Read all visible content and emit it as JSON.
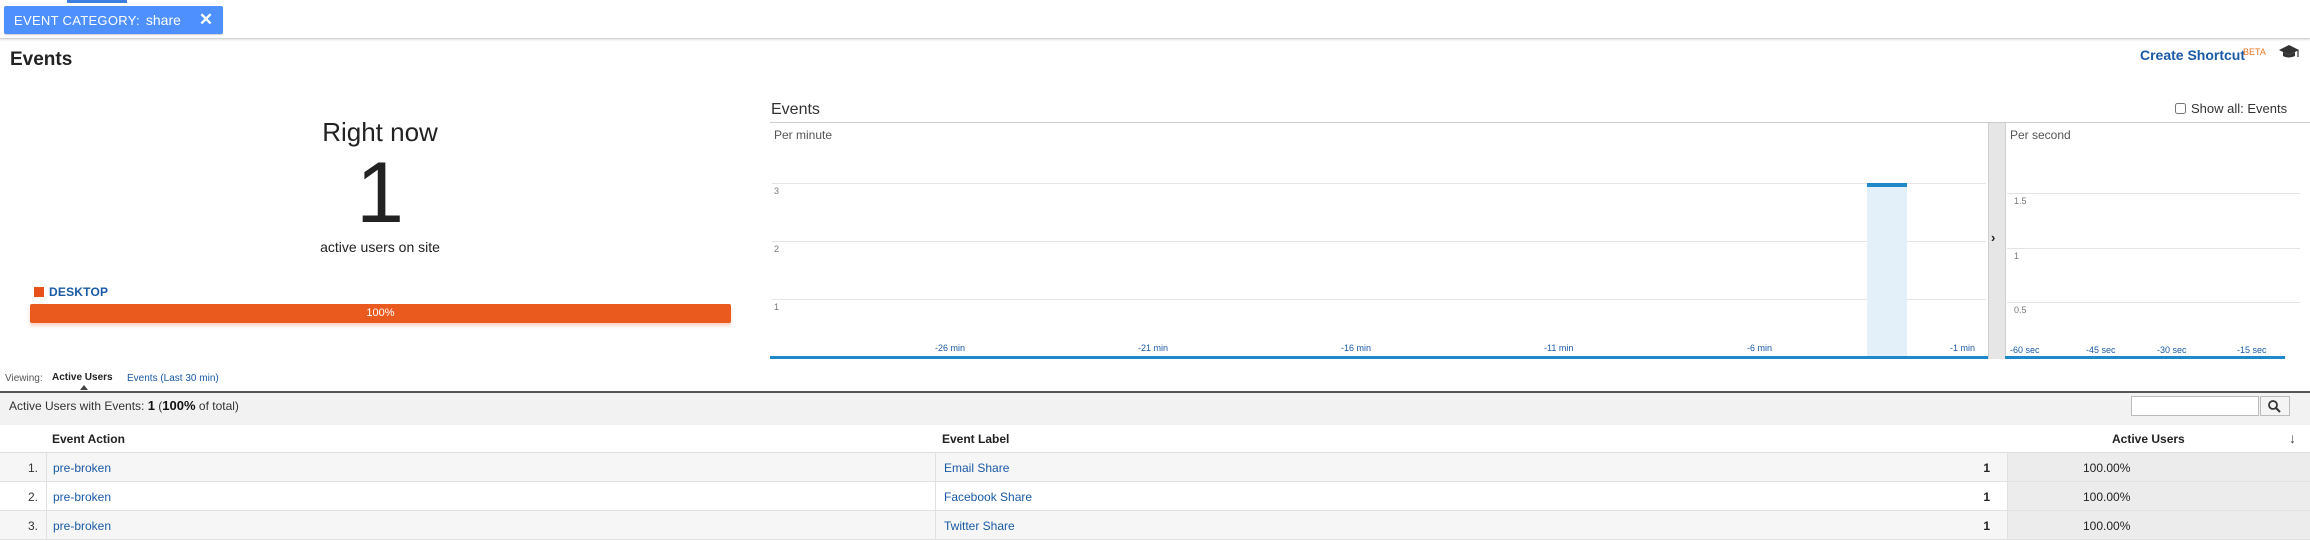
{
  "filter": {
    "key": "EVENT CATEGORY:",
    "value": "share",
    "remove_label": "✕"
  },
  "page_title": "Events",
  "header": {
    "create_shortcut": "Create Shortcut",
    "beta": "BETA",
    "icon": "graduation-cap-icon"
  },
  "right_now": {
    "title": "Right now",
    "count": "1",
    "subtitle": "active users on site",
    "device_label": "DESKTOP",
    "device_percent_label": "100%",
    "device_share": 1.0,
    "device_color": "#ea5a1f"
  },
  "events_chart": {
    "title": "Events",
    "show_all_label": "Show all: Events",
    "show_all_checked": false,
    "per_minute_label": "Per minute",
    "per_second_label": "Per second",
    "divider_icon": "chevron-right-icon",
    "accent_color": "#1e88c8"
  },
  "chart_data": [
    {
      "type": "bar",
      "subtitle": "Per minute",
      "y_ticks": [
        "1",
        "2",
        "3"
      ],
      "x_ticks": [
        "-26 min",
        "-21 min",
        "-16 min",
        "-11 min",
        "-6 min",
        "-1 min"
      ],
      "x": [
        "-30 min..-1 min"
      ],
      "bars": [
        {
          "minute": -3,
          "value": 3
        }
      ],
      "ylim": [
        0,
        3
      ]
    },
    {
      "type": "bar",
      "subtitle": "Per second",
      "y_ticks": [
        "0.5",
        "1",
        "1.5"
      ],
      "x_ticks": [
        "-60 sec",
        "-45 sec",
        "-30 sec",
        "-15 sec"
      ],
      "bars": [],
      "ylim": [
        0,
        1.5
      ]
    }
  ],
  "viewing": {
    "label": "Viewing:",
    "active_tab": "Active Users",
    "other_tab": "Events (Last 30 min)"
  },
  "summary": {
    "prefix": "Active Users with Events:",
    "count": "1",
    "pct": "100%",
    "suffix": "of total)",
    "open_paren": "("
  },
  "table": {
    "columns": {
      "action": "Event Action",
      "label": "Event Label",
      "metric": "Active Users"
    },
    "sort_icon": "sort-desc-arrow-icon",
    "rows": [
      {
        "num": "1.",
        "action": "pre-broken",
        "label": "Email Share",
        "value": "1",
        "pct": "100.00%"
      },
      {
        "num": "2.",
        "action": "pre-broken",
        "label": "Facebook Share",
        "value": "1",
        "pct": "100.00%"
      },
      {
        "num": "3.",
        "action": "pre-broken",
        "label": "Twitter Share",
        "value": "1",
        "pct": "100.00%"
      }
    ]
  }
}
